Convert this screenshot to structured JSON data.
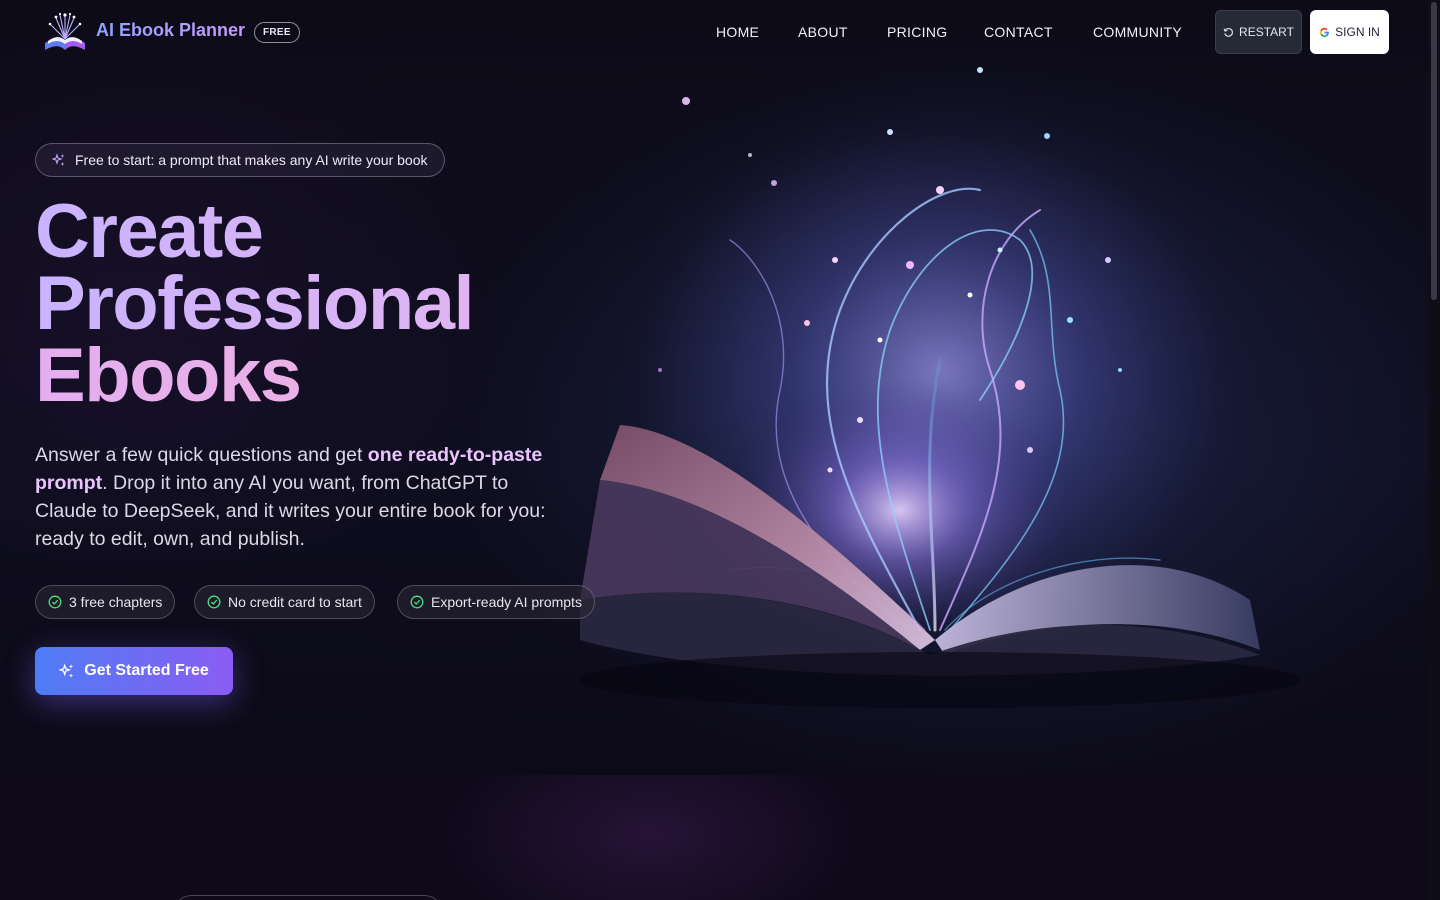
{
  "header": {
    "brand": "AI Ebook Planner",
    "badge": "FREE",
    "nav": [
      "HOME",
      "ABOUT",
      "PRICING",
      "CONTACT",
      "COMMUNITY"
    ],
    "restart_label": "RESTART",
    "signin_label": "SIGN IN"
  },
  "hero": {
    "tag": "Free to start: a prompt that makes any AI write your book",
    "headline": [
      "Create",
      "Professional",
      "Ebooks"
    ],
    "lead_pre": "Answer a few quick questions and get ",
    "lead_bold": "one ready-to-paste prompt",
    "lead_post": ". Drop it into any AI you want, from ChatGPT to Claude to DeepSeek, and it writes your entire book for you: ready to edit, own, and publish.",
    "chips": [
      "3 free chapters",
      "No credit card to start",
      "Export-ready AI prompts"
    ],
    "cta_label": "Get Started Free"
  },
  "icons": {
    "logo": "open-book-logo-icon",
    "tag": "sparkles-icon",
    "restart": "rotate-ccw-icon",
    "signin": "google-icon",
    "chip": "check-circle-icon",
    "cta": "sparkles-icon"
  },
  "colors": {
    "background": "#0b0914",
    "accent_blue": "#4e7cf6",
    "accent_purple": "#8b5cf6",
    "headline": "#d8b4fe",
    "chip_check": "#4ade80"
  }
}
